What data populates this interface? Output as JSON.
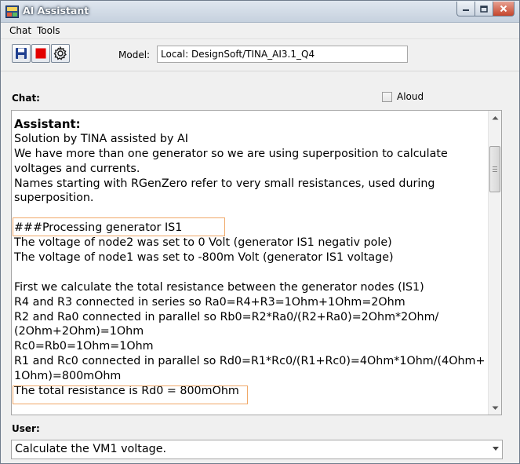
{
  "window": {
    "title": "AI Assistant"
  },
  "menu": {
    "items": [
      {
        "label": "Chat"
      },
      {
        "label": "Tools"
      }
    ]
  },
  "toolbar": {
    "buttons": [
      {
        "icon": "save-icon"
      },
      {
        "icon": "stop-icon"
      },
      {
        "icon": "gear-icon"
      }
    ],
    "model_label": "Model:",
    "model_value": "Local: DesignSoft/TINA_AI3.1_Q4"
  },
  "chat": {
    "label": "Chat:",
    "aloud_label": "Aloud",
    "aloud_checked": false,
    "lines": [
      "Assistant:",
      "Solution by TINA assisted by AI",
      "We have more than one generator so we are using superposition to calculate",
      "voltages and currents.",
      "Names starting with RGenZero refer to very small resistances, used during",
      "superposition.",
      "",
      "###Processing generator IS1",
      "The voltage of node2 was set to 0 Volt (generator IS1 negativ pole)",
      "The voltage of node1 was set to -800m Volt (generator IS1 voltage)",
      "",
      "First we calculate the total resistance between the generator nodes (IS1)",
      "R4 and R3 connected in series so Ra0=R4+R3=1Ohm+1Ohm=2Ohm",
      "R2 and Ra0 connected in parallel so Rb0=R2*Ra0/(R2+Ra0)=2Ohm*2Ohm/",
      "(2Ohm+2Ohm)=1Ohm",
      "Rc0=Rb0=1Ohm=1Ohm",
      "R1 and Rc0 connected in parallel so Rd0=R1*Rc0/(R1+Rc0)=4Ohm*1Ohm/(4Ohm+",
      "1Ohm)=800mOhm",
      "The total resistance is Rd0 = 800mOhm"
    ],
    "highlight_color": "#f0a868"
  },
  "user": {
    "label": "User:",
    "input_value": "Calculate the VM1 voltage."
  }
}
